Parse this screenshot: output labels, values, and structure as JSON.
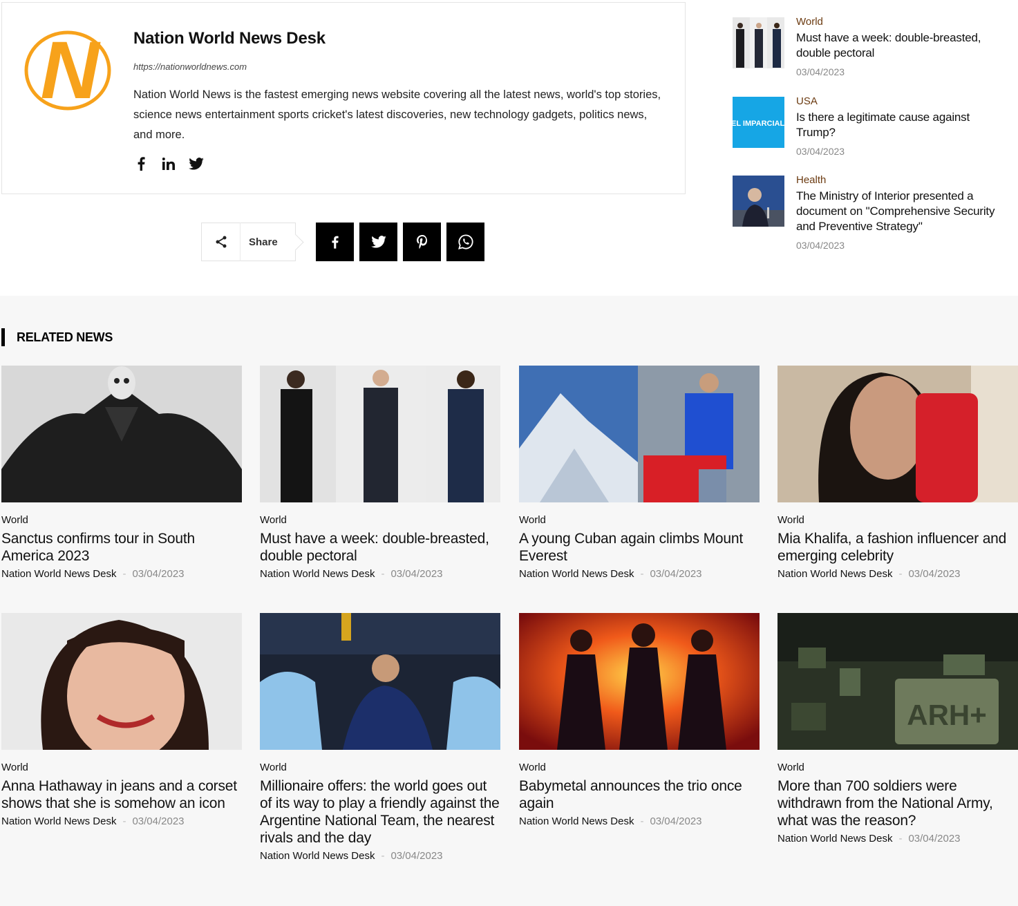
{
  "author": {
    "name": "Nation World News Desk",
    "url": "https://nationworldnews.com",
    "logo_letter": "N",
    "description": "Nation World News is the fastest emerging news website covering all the latest news, world's top stories, science news entertainment sports cricket's latest discoveries, new technology gadgets, politics news, and more.",
    "social": [
      "facebook-icon",
      "linkedin-icon",
      "twitter-icon"
    ]
  },
  "share": {
    "label": "Share",
    "buttons": [
      "facebook-icon",
      "twitter-icon",
      "pinterest-icon",
      "whatsapp-icon"
    ]
  },
  "sidebar": {
    "items": [
      {
        "category": "World",
        "title": "Must have a week: double-breasted, double pectoral",
        "date": "03/04/2023"
      },
      {
        "category": "USA",
        "title": "Is there a legitimate cause against Trump?",
        "date": "03/04/2023",
        "thumb_text": "EL IMPARCIAL"
      },
      {
        "category": "Health",
        "title": "The Ministry of Interior presented a document on \"Comprehensive Security and Preventive Strategy\"",
        "date": "03/04/2023"
      }
    ]
  },
  "related": {
    "heading": "RELATED NEWS",
    "cards": [
      {
        "category": "World",
        "title": "Sanctus confirms tour in South America 2023",
        "author": "Nation World News Desk",
        "date": "03/04/2023"
      },
      {
        "category": "World",
        "title": "Must have a week: double-breasted, double pectoral",
        "author": "Nation World News Desk",
        "date": "03/04/2023"
      },
      {
        "category": "World",
        "title": "A young Cuban again climbs Mount Everest",
        "author": "Nation World News Desk",
        "date": "03/04/2023"
      },
      {
        "category": "World",
        "title": "Mia Khalifa, a fashion influencer and emerging celebrity",
        "author": "Nation World News Desk",
        "date": "03/04/2023"
      },
      {
        "category": "World",
        "title": "Anna Hathaway in jeans and a corset shows that she is somehow an icon",
        "author": "Nation World News Desk",
        "date": "03/04/2023"
      },
      {
        "category": "World",
        "title": "Millionaire offers: the world goes out of its way to play a friendly against the Argentine National Team, the nearest rivals and the day",
        "author": "Nation World News Desk",
        "date": "03/04/2023"
      },
      {
        "category": "World",
        "title": "Babymetal announces the trio once again",
        "author": "Nation World News Desk",
        "date": "03/04/2023"
      },
      {
        "category": "World",
        "title": "More than 700 soldiers were withdrawn from the National Army, what was the reason?",
        "author": "Nation World News Desk",
        "date": "03/04/2023",
        "image_text": "ARH+"
      }
    ]
  },
  "colors": {
    "logo_orange": "#f7a21b",
    "share_button": "#000000",
    "related_bg": "#f7f7f7"
  }
}
